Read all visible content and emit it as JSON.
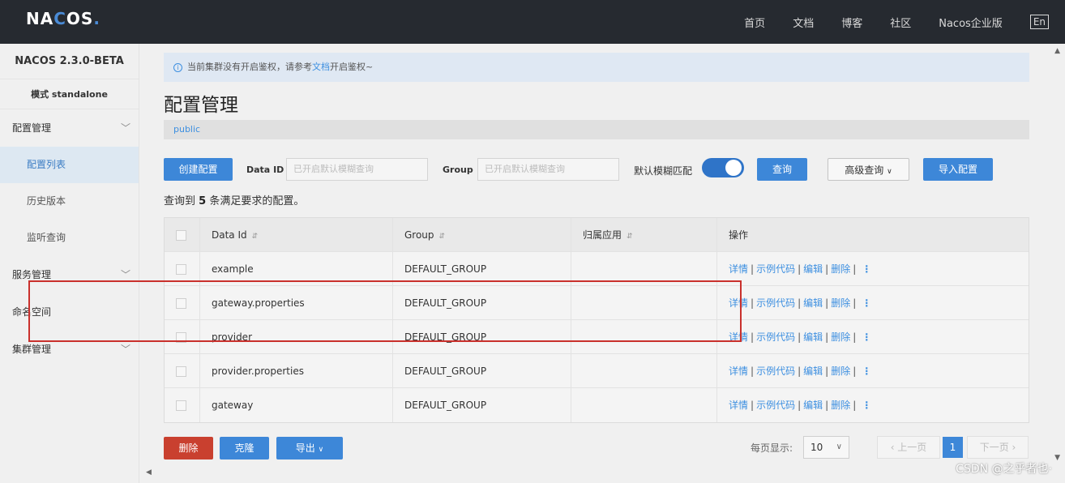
{
  "topbar": {
    "logo": "NACOS.",
    "nav": [
      "首页",
      "文档",
      "博客",
      "社区",
      "Nacos企业版"
    ],
    "lang": "En"
  },
  "sidebar": {
    "version": "NACOS 2.3.0-BETA",
    "mode": "模式 standalone",
    "groups": [
      {
        "label": "配置管理",
        "items": [
          "配置列表",
          "历史版本",
          "监听查询"
        ]
      },
      {
        "label": "服务管理"
      },
      {
        "label": "命名空间"
      },
      {
        "label": "集群管理"
      }
    ]
  },
  "notice": {
    "text_before": "当前集群没有开启鉴权，请参考",
    "link": "文档",
    "text_after": "开启鉴权~"
  },
  "page_title": "配置管理",
  "namespace": "public",
  "toolbar": {
    "create": "创建配置",
    "data_id_label": "Data ID",
    "data_id_placeholder": "已开启默认模糊查询",
    "group_label": "Group",
    "group_placeholder": "已开启默认模糊查询",
    "fuzzy_label": "默认模糊匹配",
    "fuzzy_on": true,
    "query": "查询",
    "advanced": "高级查询",
    "import": "导入配置"
  },
  "result": {
    "prefix": "查询到",
    "count": "5",
    "suffix": "条满足要求的配置。"
  },
  "table": {
    "headers": [
      "Data Id",
      "Group",
      "归属应用",
      "操作"
    ],
    "rows": [
      {
        "data_id": "example",
        "group": "DEFAULT_GROUP",
        "app": ""
      },
      {
        "data_id": "gateway.properties",
        "group": "DEFAULT_GROUP",
        "app": ""
      },
      {
        "data_id": "provider",
        "group": "DEFAULT_GROUP",
        "app": ""
      },
      {
        "data_id": "provider.properties",
        "group": "DEFAULT_GROUP",
        "app": ""
      },
      {
        "data_id": "gateway",
        "group": "DEFAULT_GROUP",
        "app": ""
      }
    ],
    "ops": [
      "详情",
      "示例代码",
      "编辑",
      "删除"
    ]
  },
  "footer": {
    "delete": "删除",
    "clone": "克隆",
    "export": "导出",
    "page_size_label": "每页显示:",
    "page_size": "10",
    "prev": "‹ 上一页",
    "current_page": "1",
    "next": "下一页 ›"
  },
  "watermark": "CSDN @之乎者也·"
}
